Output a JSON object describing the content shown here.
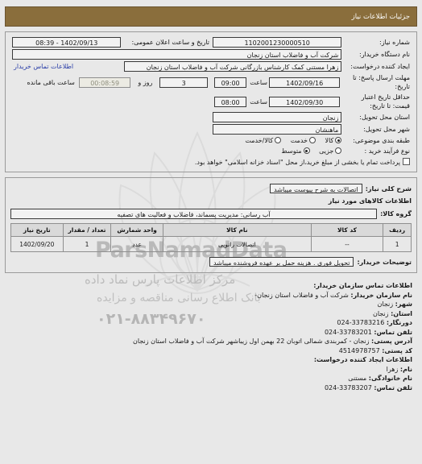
{
  "header": {
    "title": "جزئیات اطلاعات نیاز"
  },
  "form": {
    "need_number_label": "شماره نیاز:",
    "need_number_value": "1102001230000510",
    "announce_datetime_label": "تاریخ و ساعت اعلان عمومی:",
    "announce_datetime_value": "1402/09/13 - 08:39",
    "buyer_org_label": "نام دستگاه خریدار:",
    "buyer_org_value": "شرکت آب و فاضلاب استان زنجان",
    "creator_label": "ایجاد کننده درخواست:",
    "creator_value": "زهرا مستنی کمک کارشناس بازرگانی شرکت آب و فاضلاب استان زنجان",
    "buyer_contact_link": "اطلاعات تماس خریدار",
    "deadline_label": "مهلت ارسال پاسخ: تا تاریخ:",
    "deadline_date": "1402/09/16",
    "deadline_time_label": "ساعت",
    "deadline_time": "09:00",
    "remaining_days": "3",
    "remaining_days_label": "روز و",
    "remaining_time": "00:08:59",
    "remaining_time_label": "ساعت باقی مانده",
    "price_validity_label": "حداقل تاریخ اعتبار قیمت: تا تاریخ:",
    "price_validity_date": "1402/09/30",
    "price_validity_time_label": "ساعت",
    "price_validity_time": "08:00",
    "delivery_province_label": "استان محل تحویل:",
    "delivery_province_value": "زنجان",
    "delivery_city_label": "شهر محل تحویل:",
    "delivery_city_value": "ماهنشان",
    "subject_class_label": "طبقه بندی موضوعی:",
    "subject_options": [
      {
        "label": "کالا",
        "selected": true
      },
      {
        "label": "خدمت",
        "selected": false
      },
      {
        "label": "کالا/خدمت",
        "selected": false
      }
    ],
    "purchase_type_label": "نوع فرآیند خرید :",
    "purchase_options": [
      {
        "label": "جزیی",
        "selected": false
      },
      {
        "label": "متوسط",
        "selected": true
      }
    ],
    "treasury_checkbox_label": "پرداخت تمام یا بخشی از مبلغ خرید،از محل \"اسناد خزانه اسلامی\" خواهد بود.",
    "treasury_checked": false
  },
  "description": {
    "summary_label": "شرح کلی نیاز:",
    "summary_value": "اتصالات به شرح پیوست میباشد",
    "goods_info_title": "اطلاعات کالاهای مورد نیاز",
    "group_label": "گروه کالا:",
    "group_value": "آب رسانی: مدیریت پسماند، فاضلاب و فعالیت های تصفیه"
  },
  "goods_table": {
    "columns": [
      "ردیف",
      "کد کالا",
      "نام کالا",
      "واحد شمارش",
      "تعداد / مقدار",
      "تاریخ نیاز"
    ],
    "rows": [
      {
        "row": "1",
        "code": "--",
        "name": "اتصالات رانویی",
        "unit": "عدد",
        "quantity": "1",
        "need_date": "1402/09/20"
      }
    ]
  },
  "buyer_notes": {
    "label": "توضیحات خریدار:",
    "value": "تحویل فوری . هزینه حمل بر عهده فروشنده میباشد"
  },
  "contacts": {
    "org_section_title": "اطلاعات تماس سازمان خریدار:",
    "org_name_key": "نام سازمان خریدار:",
    "org_name_value": "شرکت آب و فاضلاب استان زنجان-",
    "city_key": "شهر:",
    "city_value": "زنجان",
    "province_key": "استان:",
    "province_value": "زنجان",
    "fax_key": "دورنگار:",
    "fax_value": "024-33783216",
    "phone_key": "تلفن تماس:",
    "phone_value": "024-33783201",
    "address_key": "آدرس پستی:",
    "address_value": "زنجان - کمربندی شمالی اتوبان 22 بهمن اول زیباشهر شرکت آب و فاضلاب استان زنجان",
    "postal_code_key": "کد پستی:",
    "postal_code_value": "4514978757",
    "creator_section_title": "اطلاعات ایجاد کننده درخواست:",
    "first_name_key": "نام:",
    "first_name_value": "زهرا",
    "last_name_key": "نام خانوادگی:",
    "last_name_value": "مستنی",
    "creator_phone_key": "تلفن تماس:",
    "creator_phone_value": "024-33783207"
  },
  "watermark": {
    "latin": "ParsNamadData",
    "persian_line1": "مرکز اطلاعات پارس نماد داده",
    "persian_line2": "بانک اطلاع رسانی مناقصه و مزایده",
    "phone": "۰۲۱-۸۸۳۴۹۶۷۰"
  },
  "colors": {
    "titlebar_bg": "#8a6e3c",
    "page_bg": "#e8e8e8",
    "link": "#2a3ea8"
  }
}
